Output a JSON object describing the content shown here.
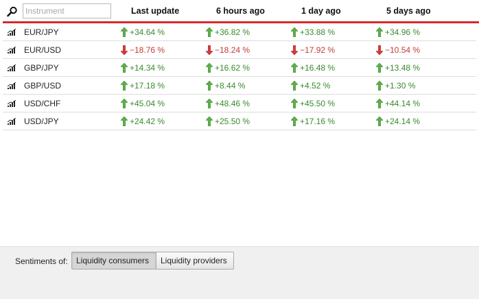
{
  "search": {
    "placeholder": "Instrument",
    "value": ""
  },
  "columns": [
    "Last update",
    "6 hours ago",
    "1 day ago",
    "5 days ago"
  ],
  "rows": [
    {
      "instrument": "EUR/JPY",
      "values": [
        {
          "text": "+34.64 %",
          "dir": "up"
        },
        {
          "text": "+36.82 %",
          "dir": "up"
        },
        {
          "text": "+33.88 %",
          "dir": "up"
        },
        {
          "text": "+34.96 %",
          "dir": "up"
        }
      ]
    },
    {
      "instrument": "EUR/USD",
      "values": [
        {
          "text": "−18.76 %",
          "dir": "down"
        },
        {
          "text": "−18.24 %",
          "dir": "down"
        },
        {
          "text": "−17.92 %",
          "dir": "down"
        },
        {
          "text": "−10.54 %",
          "dir": "down"
        }
      ]
    },
    {
      "instrument": "GBP/JPY",
      "values": [
        {
          "text": "+14.34 %",
          "dir": "up"
        },
        {
          "text": "+16.62 %",
          "dir": "up"
        },
        {
          "text": "+16.48 %",
          "dir": "up"
        },
        {
          "text": "+13.48 %",
          "dir": "up"
        }
      ]
    },
    {
      "instrument": "GBP/USD",
      "values": [
        {
          "text": "+17.18 %",
          "dir": "up"
        },
        {
          "text": "+8.44 %",
          "dir": "up"
        },
        {
          "text": "+4.52 %",
          "dir": "up"
        },
        {
          "text": "+1.30 %",
          "dir": "up"
        }
      ]
    },
    {
      "instrument": "USD/CHF",
      "values": [
        {
          "text": "+45.04 %",
          "dir": "up"
        },
        {
          "text": "+48.46 %",
          "dir": "up"
        },
        {
          "text": "+45.50 %",
          "dir": "up"
        },
        {
          "text": "+44.14 %",
          "dir": "up"
        }
      ]
    },
    {
      "instrument": "USD/JPY",
      "values": [
        {
          "text": "+24.42 %",
          "dir": "up"
        },
        {
          "text": "+25.50 %",
          "dir": "up"
        },
        {
          "text": "+17.16 %",
          "dir": "up"
        },
        {
          "text": "+24.14 %",
          "dir": "up"
        }
      ]
    }
  ],
  "footer": {
    "label": "Sentiments of:",
    "options": [
      "Liquidity consumers",
      "Liquidity providers"
    ],
    "selected": "Liquidity consumers"
  },
  "icons": {
    "search": "magnifier-icon",
    "row": "chart-bars-icon",
    "up": "arrow-up-icon",
    "down": "arrow-down-icon"
  },
  "colors": {
    "accent_rule": "#d42a2a",
    "positive": "#3a8a2e",
    "negative": "#c43a3a",
    "arrow_up": "#5fb04a",
    "arrow_down": "#d43c3c"
  }
}
